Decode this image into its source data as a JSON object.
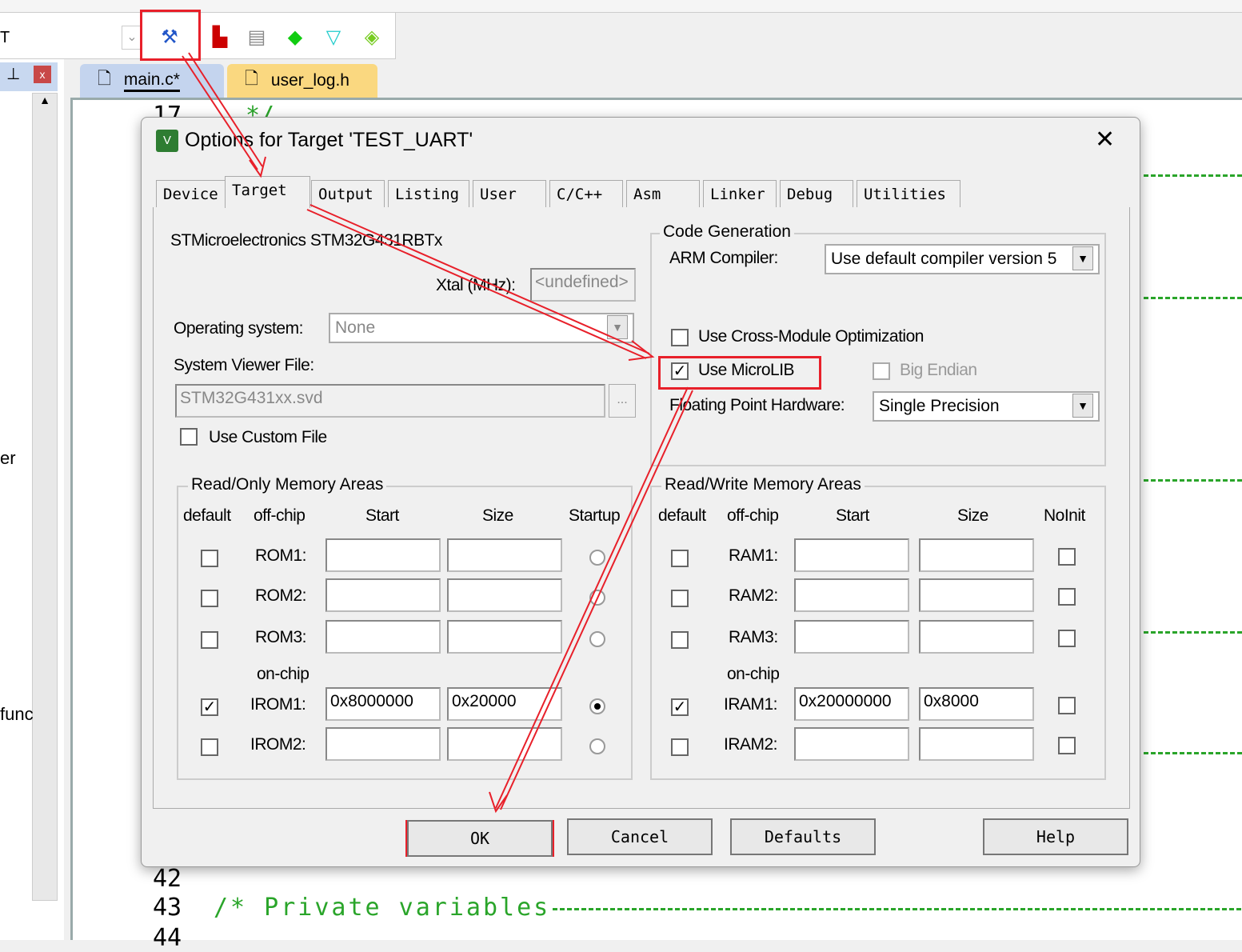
{
  "ide": {
    "toolbar_left_char": "T",
    "tabs": [
      {
        "label": "main.c*"
      },
      {
        "label": "user_log.h"
      }
    ],
    "line_numbers": {
      "top": "17",
      "l42": "42",
      "l43": "43",
      "l44": "44"
    },
    "code": {
      "top": "*/",
      "l43": "/* Private variables "
    },
    "left_fragments": {
      "er": "er",
      "func": "func"
    },
    "toolbar_icons": [
      "options-for-target-icon",
      "translate-icon",
      "batch-build-icon",
      "manage-components-icon",
      "filter-icon",
      "pack-installer-icon"
    ]
  },
  "dialog": {
    "title": "Options for Target 'TEST_UART'",
    "tabs": [
      "Device",
      "Target",
      "Output",
      "Listing",
      "User",
      "C/C++",
      "Asm",
      "Linker",
      "Debug",
      "Utilities"
    ],
    "active_tab": "Target",
    "device": "STMicroelectronics STM32G431RBTx",
    "xtal_label": "Xtal (MHz):",
    "xtal_value": "<undefined>",
    "os_label": "Operating system:",
    "os_value": "None",
    "svf_label": "System Viewer File:",
    "svf_value": "STM32G431xx.svd",
    "browse": "...",
    "custom_file": "Use Custom File",
    "codegen": {
      "legend": "Code Generation",
      "compiler_label": "ARM Compiler:",
      "compiler_value": "Use default compiler version 5",
      "cross_module": "Use Cross-Module Optimization",
      "microlib": "Use MicroLIB",
      "microlib_checked": true,
      "big_endian": "Big Endian",
      "fpu_label": "Floating Point Hardware:",
      "fpu_value": "Single Precision"
    },
    "rom": {
      "legend": "Read/Only Memory Areas",
      "headers": [
        "default",
        "off-chip",
        "Start",
        "Size",
        "Startup"
      ],
      "onchip": "on-chip",
      "rows": [
        {
          "name": "ROM1:",
          "start": "",
          "size": "",
          "default": false,
          "startup": false
        },
        {
          "name": "ROM2:",
          "start": "",
          "size": "",
          "default": false,
          "startup": false
        },
        {
          "name": "ROM3:",
          "start": "",
          "size": "",
          "default": false,
          "startup": false
        },
        {
          "name": "IROM1:",
          "start": "0x8000000",
          "size": "0x20000",
          "default": true,
          "startup": true
        },
        {
          "name": "IROM2:",
          "start": "",
          "size": "",
          "default": false,
          "startup": false
        }
      ]
    },
    "ram": {
      "legend": "Read/Write Memory Areas",
      "headers": [
        "default",
        "off-chip",
        "Start",
        "Size",
        "NoInit"
      ],
      "onchip": "on-chip",
      "rows": [
        {
          "name": "RAM1:",
          "start": "",
          "size": "",
          "default": false
        },
        {
          "name": "RAM2:",
          "start": "",
          "size": "",
          "default": false
        },
        {
          "name": "RAM3:",
          "start": "",
          "size": "",
          "default": false
        },
        {
          "name": "IRAM1:",
          "start": "0x20000000",
          "size": "0x8000",
          "default": true
        },
        {
          "name": "IRAM2:",
          "start": "",
          "size": "",
          "default": false
        }
      ]
    },
    "buttons": {
      "ok": "OK",
      "cancel": "Cancel",
      "defaults": "Defaults",
      "help": "Help"
    }
  },
  "colors": {
    "highlight": "#e8202a",
    "comment": "#2aa52a"
  }
}
